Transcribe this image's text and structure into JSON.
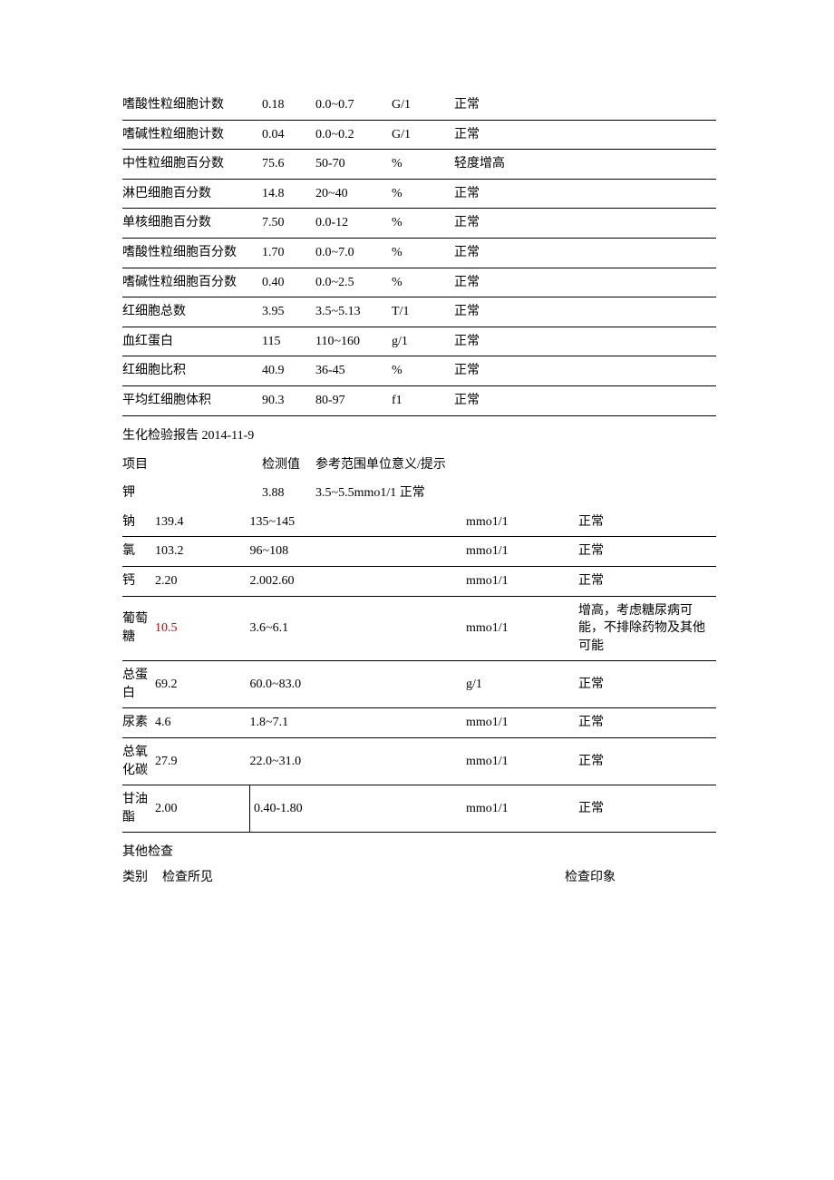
{
  "table1": {
    "rows": [
      {
        "name": "嗜酸性粒细胞计数",
        "val": "0.18",
        "ref": "0.0~0.7",
        "unit": "G/1",
        "note": "正常"
      },
      {
        "name": "嗜碱性粒细胞计数",
        "val": "0.04",
        "ref": "0.0~0.2",
        "unit": "G/1",
        "note": "正常"
      },
      {
        "name": "中性粒细胞百分数",
        "val": "75.6",
        "ref": "50-70",
        "unit": "%",
        "note": "轻度增高"
      },
      {
        "name": "淋巴细胞百分数",
        "val": "14.8",
        "ref": "20~40",
        "unit": "%",
        "note": "正常"
      },
      {
        "name": "单核细胞百分数",
        "val": "7.50",
        "ref": "0.0-12",
        "unit": "%",
        "note": "正常"
      },
      {
        "name": "嗜酸性粒细胞百分数",
        "val": "1.70",
        "ref": "0.0~7.0",
        "unit": "%",
        "note": "正常"
      },
      {
        "name": "嗜碱性粒细胞百分数",
        "val": "0.40",
        "ref": "0.0~2.5",
        "unit": "%",
        "note": "正常"
      },
      {
        "name": "红细胞总数",
        "val": "3.95",
        "ref": "3.5~5.13",
        "unit": "T/1",
        "note": "正常"
      },
      {
        "name": "血红蛋白",
        "val": "115",
        "ref": "110~160",
        "unit": "g/1",
        "note": "正常"
      },
      {
        "name": "红细胞比积",
        "val": "40.9",
        "ref": "36-45",
        "unit": "%",
        "note": "正常"
      },
      {
        "name": "平均红细胞体积",
        "val": "90.3",
        "ref": "80-97",
        "unit": "f1",
        "note": "正常"
      }
    ]
  },
  "sectionBiochem": "生化检验报告 2014-11-9",
  "table2_header": {
    "a": "项目",
    "b": "检测值",
    "c": "参考范围单位意义/提示"
  },
  "table2_k": {
    "a": "钾",
    "b": "3.88",
    "c": "3.5~5.5mmo1/1 正常"
  },
  "table3": {
    "rows": [
      {
        "c1": "钠",
        "c2": "139.4",
        "c3": "135~145",
        "c4": "mmo1/1",
        "c5": "正常",
        "red": false
      },
      {
        "c1": "氯",
        "c2": "103.2",
        "c3": "96~108",
        "c4": "mmo1/1",
        "c5": "正常",
        "red": false
      },
      {
        "c1": "钙",
        "c2": "2.20",
        "c3": "2.002.60",
        "c4": "mmo1/1",
        "c5": "正常",
        "red": false
      },
      {
        "c1": "葡萄糖",
        "c2": "10.5",
        "c3": "3.6~6.1",
        "c4": "mmo1/1",
        "c5": "增高，考虑糖尿病可能，不排除药物及其他可能",
        "red": true
      },
      {
        "c1": "总蛋白",
        "c2": "69.2",
        "c3": "60.0~83.0",
        "c4": "g/1",
        "c5": "正常",
        "red": false
      },
      {
        "c1": "尿素",
        "c2": "4.6",
        "c3": "1.8~7.1",
        "c4": "mmo1/1",
        "c5": "正常",
        "red": false
      },
      {
        "c1": "总氧化碳",
        "c2": "27.9",
        "c3": "22.0~31.0",
        "c4": "mmo1/1",
        "c5": "正常",
        "red": false
      },
      {
        "c1": "甘油酯",
        "c2": "2.00",
        "c3": "0.40-1.80",
        "c4": "mmo1/1",
        "c5": "正常",
        "red": false,
        "vsep": true
      }
    ]
  },
  "otherTitle": "其他检查",
  "otherHeader": {
    "a": "类别",
    "b": "检查所见",
    "c": "检查印象"
  }
}
